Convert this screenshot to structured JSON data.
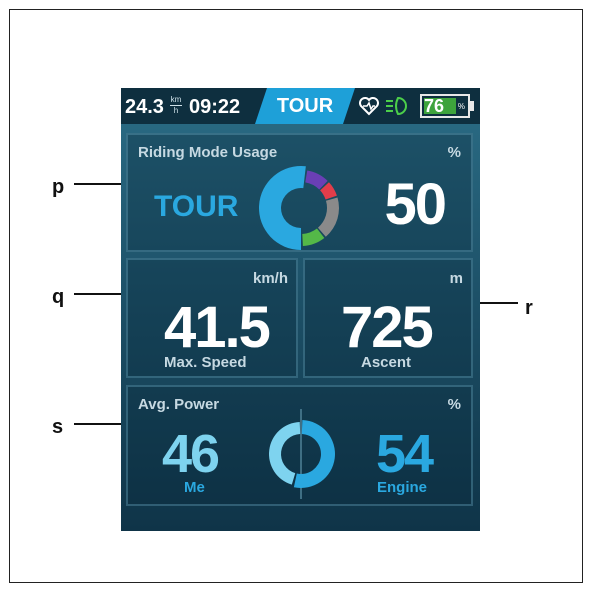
{
  "callouts": {
    "p": "p",
    "q": "q",
    "r": "r",
    "s": "s"
  },
  "status_bar": {
    "speed": "24.3",
    "speed_unit_top": "km",
    "speed_unit_bottom": "h",
    "time": "09:22",
    "mode": "TOUR",
    "icons": [
      "heart-rate-icon",
      "light-icon",
      "battery-icon"
    ],
    "battery_level": "76",
    "battery_unit": "%"
  },
  "riding_mode_usage": {
    "title": "Riding Mode Usage",
    "unit": "%",
    "mode": "TOUR",
    "value": "50",
    "segments": [
      {
        "mode": "TOUR",
        "share": 50,
        "color": "#2aa8e0"
      },
      {
        "mode": "mode-2",
        "share": 10,
        "color": "#6a3fb5"
      },
      {
        "mode": "mode-3",
        "share": 7,
        "color": "#e23d4a"
      },
      {
        "mode": "mode-4",
        "share": 18,
        "color": "#8a8a8a"
      },
      {
        "mode": "mode-5",
        "share": 10,
        "color": "#54b848"
      }
    ]
  },
  "max_speed": {
    "unit": "km/h",
    "value": "41.5",
    "label": "Max. Speed"
  },
  "ascent": {
    "unit": "m",
    "value": "725",
    "label": "Ascent"
  },
  "avg_power": {
    "title": "Avg. Power",
    "unit": "%",
    "me_value": "46",
    "me_label": "Me",
    "engine_value": "54",
    "engine_label": "Engine",
    "me_share": 46,
    "engine_share": 54
  },
  "pagination": {
    "count": 6,
    "active_index": 4
  },
  "colors": {
    "accent": "#1ea0d8",
    "me": "#7ed3ef",
    "engine": "#2aa8e0",
    "battery": "#3ea33c"
  }
}
